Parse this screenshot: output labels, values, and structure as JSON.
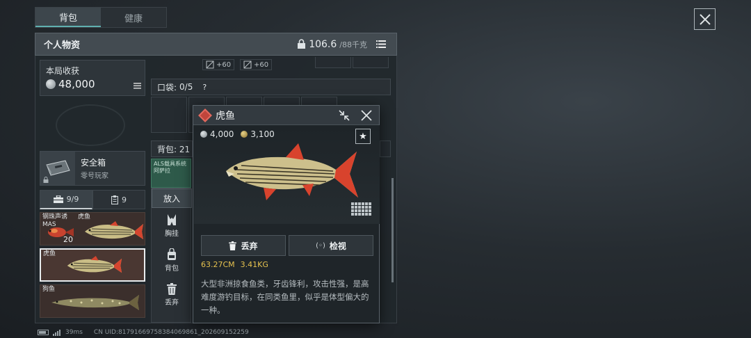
{
  "tabs": [
    {
      "label": "背包",
      "active": true
    },
    {
      "label": "健康",
      "active": false
    }
  ],
  "header": {
    "title": "个人物资",
    "weight": "106.6",
    "max_weight": "/88千克"
  },
  "harvest": {
    "label": "本局收获",
    "value": "48,000"
  },
  "safebox": {
    "name": "安全箱",
    "owner": "零号玩家"
  },
  "filters": [
    {
      "icon": "toolbox-icon",
      "count": "9/9"
    },
    {
      "icon": "clipboard-icon",
      "count": "9"
    }
  ],
  "mod_tags": [
    "+60",
    "+60"
  ],
  "pocket": {
    "label": "口袋:",
    "value": "0/5",
    "help": "?"
  },
  "bag_bar": {
    "label": "背包: 21"
  },
  "als_text": "ALS载具系统 阿萨拉",
  "actions": {
    "put": "放入",
    "chest_rig": "胸挂",
    "backpack": "背包",
    "discard": "丢弃"
  },
  "items": [
    {
      "names": [
        "钢珠声诱",
        "MAS"
      ],
      "name2": "虎鱼",
      "count": "20"
    },
    {
      "name": "虎鱼"
    },
    {
      "name": "狗鱼"
    }
  ],
  "detail": {
    "title": "虎鱼",
    "silver_price": "4,000",
    "gold_price": "3,100",
    "discard_label": "丢弃",
    "inspect_label": "检视",
    "inspect_prefix": "(◦)",
    "length": "63.27CM",
    "weight": "3.41KG",
    "description": "大型非洲掠食鱼类，牙齿锋利，攻击性强，是高难度游钓目标，在同类鱼里，似乎是体型偏大的一种。"
  },
  "status": {
    "ping": "39ms",
    "uid": "CN UID:817916697583840698​61_202609152259"
  },
  "colors": {
    "accent": "#5fb0b0",
    "rarity_red": "#c0453c",
    "size_text": "#e6c24f"
  }
}
